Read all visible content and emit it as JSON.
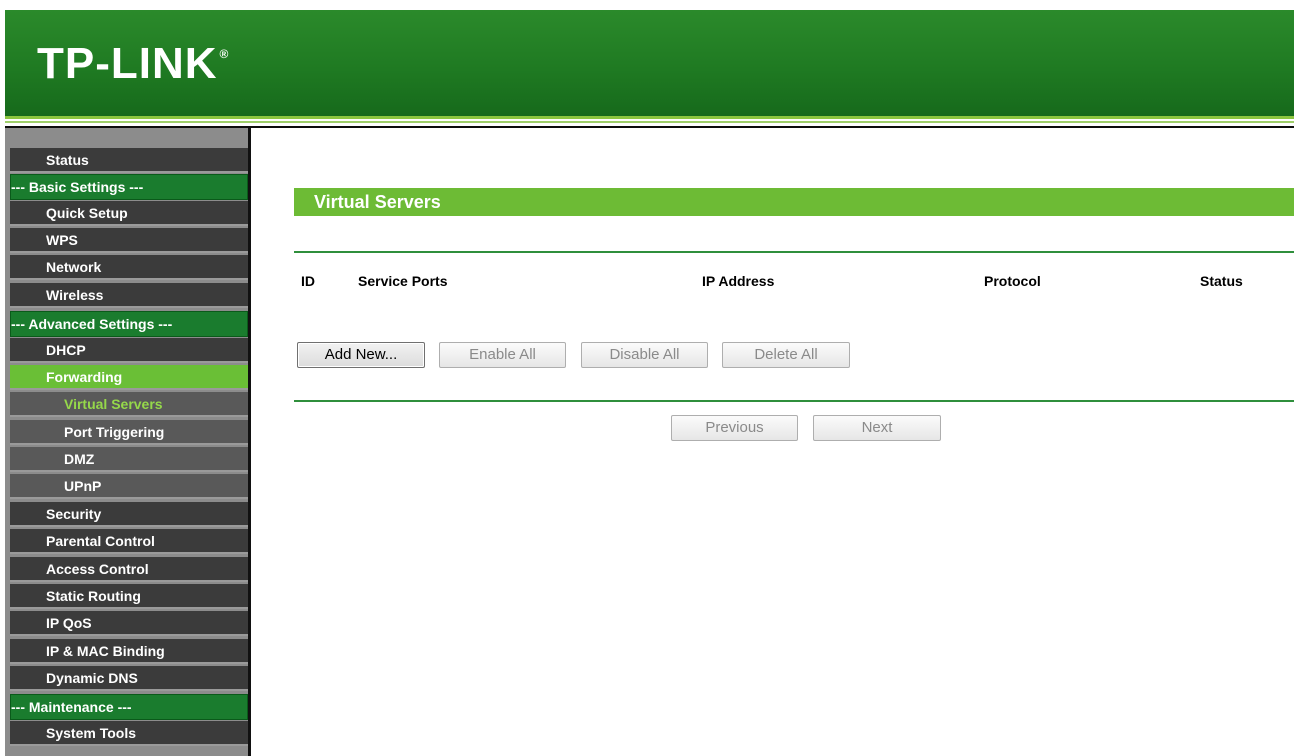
{
  "header": {
    "logo_text": "TP-LINK",
    "logo_mark": "®"
  },
  "sidebar": {
    "items": [
      {
        "label": "Status",
        "type": "item"
      },
      {
        "label": "--- Basic Settings ---",
        "type": "section"
      },
      {
        "label": "Quick Setup",
        "type": "item"
      },
      {
        "label": "WPS",
        "type": "item"
      },
      {
        "label": "Network",
        "type": "item"
      },
      {
        "label": "Wireless",
        "type": "item"
      },
      {
        "label": "--- Advanced Settings ---",
        "type": "section"
      },
      {
        "label": "DHCP",
        "type": "item"
      },
      {
        "label": "Forwarding",
        "type": "item",
        "active": true
      },
      {
        "label": "Virtual Servers",
        "type": "subitem",
        "selected": true
      },
      {
        "label": "Port Triggering",
        "type": "subitem"
      },
      {
        "label": "DMZ",
        "type": "subitem"
      },
      {
        "label": "UPnP",
        "type": "subitem"
      },
      {
        "label": "Security",
        "type": "item"
      },
      {
        "label": "Parental Control",
        "type": "item"
      },
      {
        "label": "Access Control",
        "type": "item"
      },
      {
        "label": "Static Routing",
        "type": "item"
      },
      {
        "label": "IP QoS",
        "type": "item"
      },
      {
        "label": "IP & MAC Binding",
        "type": "item"
      },
      {
        "label": "Dynamic DNS",
        "type": "item"
      },
      {
        "label": "--- Maintenance ---",
        "type": "section"
      },
      {
        "label": "System Tools",
        "type": "item"
      }
    ]
  },
  "main": {
    "title": "Virtual Servers",
    "columns": {
      "id": "ID",
      "service_ports": "Service Ports",
      "ip_address": "IP Address",
      "protocol": "Protocol",
      "status": "Status"
    },
    "buttons": {
      "add_new": "Add New...",
      "enable_all": "Enable All",
      "disable_all": "Disable All",
      "delete_all": "Delete All",
      "previous": "Previous",
      "next": "Next"
    }
  },
  "colors": {
    "brand_green": "#1f7a22",
    "accent_green": "#6dbb35",
    "sidebar_dark": "#3b3b3b",
    "section_green": "#1a7c2e"
  }
}
